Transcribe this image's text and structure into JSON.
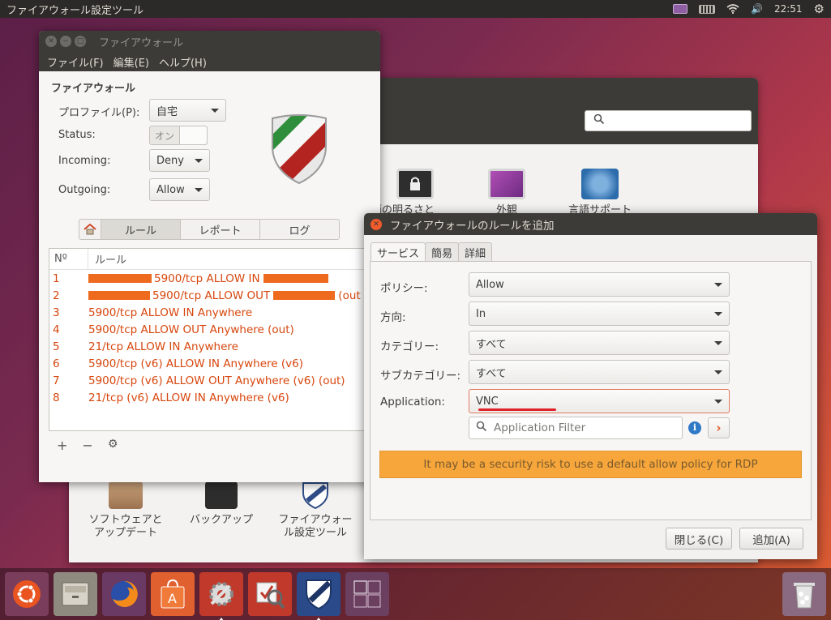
{
  "top_panel": {
    "app_title": "ファイアウォール設定ツール",
    "clock": "22:51",
    "volume_glyph": "🔊",
    "power_glyph": "⚙"
  },
  "bg_window": {
    "icons": [
      {
        "label": "面の明るさと",
        "icon": "lock-icon"
      },
      {
        "label": "外観",
        "icon": "appearance-icon"
      },
      {
        "label": "言語サポート",
        "icon": "globe-icon"
      },
      {
        "label": "ソフトウェアと\nアップデート",
        "icon": "software-icon"
      },
      {
        "label": "バックアップ",
        "icon": "safe-icon"
      },
      {
        "label": "ファイアウォー\nル設定ツール",
        "icon": "shield-icon"
      }
    ]
  },
  "fw_window": {
    "title": "ファイアウォール",
    "menu": [
      "ファイル(F)",
      "編集(E)",
      "ヘルプ(H)"
    ],
    "heading": "ファイアウォール",
    "profile_label": "プロファイル(P):",
    "profile_value": "自宅",
    "status_label": "Status:",
    "status_value": "オン",
    "incoming_label": "Incoming:",
    "incoming_value": "Deny",
    "outgoing_label": "Outgoing:",
    "outgoing_value": "Allow",
    "tabs": [
      "ルール",
      "レポート",
      "ログ"
    ],
    "rules_header": {
      "no": "Nº",
      "rule": "ルール"
    },
    "rules": [
      {
        "n": "1",
        "pre_redact": true,
        "text": "5900/tcp ALLOW IN",
        "post_redact": true,
        "suffix": ""
      },
      {
        "n": "2",
        "pre_redact": true,
        "text": "5900/tcp ALLOW OUT",
        "post_redact": true,
        "suffix": "(out"
      },
      {
        "n": "3",
        "pre_redact": false,
        "text": "5900/tcp ALLOW IN Anywhere",
        "post_redact": false,
        "suffix": ""
      },
      {
        "n": "4",
        "pre_redact": false,
        "text": "5900/tcp ALLOW OUT Anywhere (out)",
        "post_redact": false,
        "suffix": ""
      },
      {
        "n": "5",
        "pre_redact": false,
        "text": "21/tcp ALLOW IN Anywhere",
        "post_redact": false,
        "suffix": ""
      },
      {
        "n": "6",
        "pre_redact": false,
        "text": "5900/tcp (v6) ALLOW IN Anywhere (v6)",
        "post_redact": false,
        "suffix": ""
      },
      {
        "n": "7",
        "pre_redact": false,
        "text": "5900/tcp (v6) ALLOW OUT Anywhere (v6) (out)",
        "post_redact": false,
        "suffix": ""
      },
      {
        "n": "8",
        "pre_redact": false,
        "text": "21/tcp (v6) ALLOW IN Anywhere (v6)",
        "post_redact": false,
        "suffix": ""
      }
    ],
    "tools": {
      "add": "+",
      "remove": "−",
      "settings": "⚙"
    }
  },
  "dialog": {
    "title": "ファイアウォールのルールを追加",
    "tabs": [
      "サービス",
      "簡易",
      "詳細"
    ],
    "policy_label": "ポリシー:",
    "policy_value": "Allow",
    "direction_label": "方向:",
    "direction_value": "In",
    "category_label": "カテゴリー:",
    "category_value": "すべて",
    "subcategory_label": "サブカテゴリー:",
    "subcategory_value": "すべて",
    "application_label": "Application:",
    "application_value": "VNC",
    "filter_placeholder": "Application Filter",
    "warning": "It may be a security risk to use a default allow policy for RDP",
    "close_button": "閉じる(C)",
    "add_button": "追加(A)"
  },
  "colors": {
    "rule_text": "#d7460d",
    "warning_bg": "#f6a63a",
    "accent": "#e95420"
  }
}
